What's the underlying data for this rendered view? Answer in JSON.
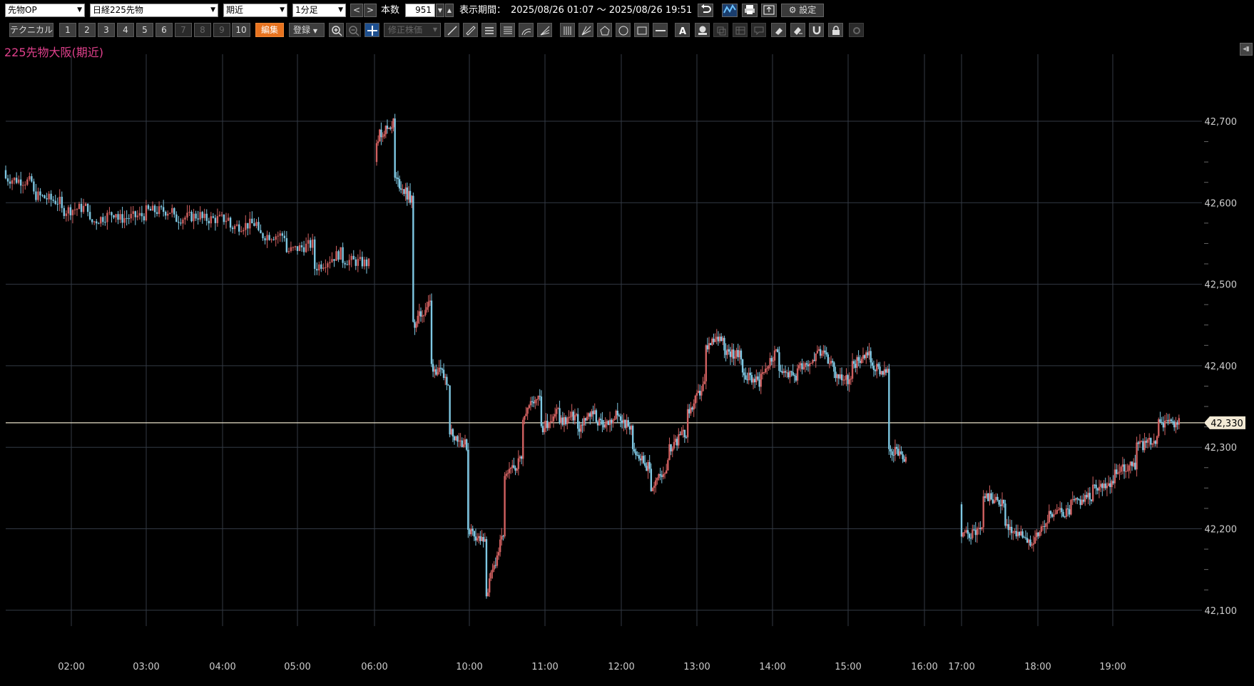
{
  "toolbar": {
    "category_select": "先物OP",
    "instrument_select": "日経225先物",
    "contract_select": "期近",
    "interval_select": "1分足",
    "prev_label": "<",
    "next_label": ">",
    "bar_count_label": "本数",
    "bar_count_value": "951",
    "period_label": "表示期間：",
    "period_value": "2025/08/26 01:07 ～ 2025/08/26 19:51",
    "settings_label": "設定"
  },
  "toolbar2": {
    "technical_label": "テクニカル",
    "presets": [
      "1",
      "2",
      "3",
      "4",
      "5",
      "6",
      "7",
      "8",
      "9",
      "10"
    ],
    "edit_label": "編集",
    "register_label": "登録",
    "adjusted_price_label": "修正株価"
  },
  "chart_title": "225先物大阪(期近)",
  "colors": {
    "up": "#d06060",
    "down": "#7ec8e3",
    "grid": "#333a45",
    "current_line": "#e8e0c8",
    "axis_text": "#cccccc",
    "title": "#e0408c"
  },
  "chart_data": {
    "type": "candlestick",
    "x_ticks": [
      "02:00",
      "03:00",
      "04:00",
      "05:00",
      "06:00",
      "10:00",
      "11:00",
      "12:00",
      "13:00",
      "14:00",
      "15:00",
      "16:00",
      "17:00",
      "18:00",
      "19:00"
    ],
    "y_ticks": [
      "42,700",
      "42,600",
      "42,500",
      "42,400",
      "42,300",
      "42,200",
      "42,100"
    ],
    "y_range": [
      42050,
      42750
    ],
    "current_price": "42,330",
    "series": [
      {
        "segment": "night1",
        "path": [
          [
            42640,
            42630
          ],
          [
            42625,
            42610
          ],
          [
            42600,
            42590
          ],
          [
            42595,
            42575
          ],
          [
            42590,
            42580
          ],
          [
            42585,
            42590
          ],
          [
            42590,
            42580
          ],
          [
            42585,
            42580
          ],
          [
            42580,
            42570
          ],
          [
            42575,
            42560
          ],
          [
            42560,
            42540
          ],
          [
            42550,
            42520
          ],
          [
            42540,
            42530
          ],
          [
            42525,
            42510
          ]
        ]
      },
      {
        "segment": "early",
        "path": [
          [
            42650,
            42680
          ],
          [
            42700,
            42630
          ],
          [
            42600,
            42450
          ],
          [
            42480,
            42400
          ],
          [
            42380,
            42320
          ],
          [
            42300,
            42200
          ],
          [
            42180,
            42120
          ],
          [
            42200,
            42260
          ],
          [
            42290,
            42340
          ],
          [
            42370,
            42320
          ],
          [
            42350,
            42330
          ],
          [
            42340,
            42320
          ],
          [
            42350,
            42330
          ],
          [
            42330,
            42340
          ],
          [
            42320,
            42300
          ],
          [
            42270,
            42250
          ],
          [
            42280,
            42300
          ],
          [
            42320,
            42340
          ],
          [
            42380,
            42420
          ],
          [
            42440,
            42420
          ],
          [
            42410,
            42390
          ],
          [
            42380,
            42390
          ],
          [
            42420,
            42400
          ],
          [
            42380,
            42400
          ],
          [
            42410,
            42420
          ],
          [
            42400,
            42390
          ],
          [
            42380,
            42400
          ],
          [
            42420,
            42400
          ],
          [
            42390,
            42300
          ],
          [
            42280,
            42260
          ]
        ]
      },
      {
        "segment": "evening",
        "path": [
          [
            42230,
            42190
          ],
          [
            42200,
            42240
          ],
          [
            42230,
            42200
          ],
          [
            42190,
            42180
          ],
          [
            42210,
            42220
          ],
          [
            42220,
            42230
          ],
          [
            42240,
            42250
          ],
          [
            42260,
            42270
          ],
          [
            42280,
            42300
          ],
          [
            42310,
            42330
          ],
          [
            42330,
            42320
          ]
        ]
      }
    ]
  }
}
